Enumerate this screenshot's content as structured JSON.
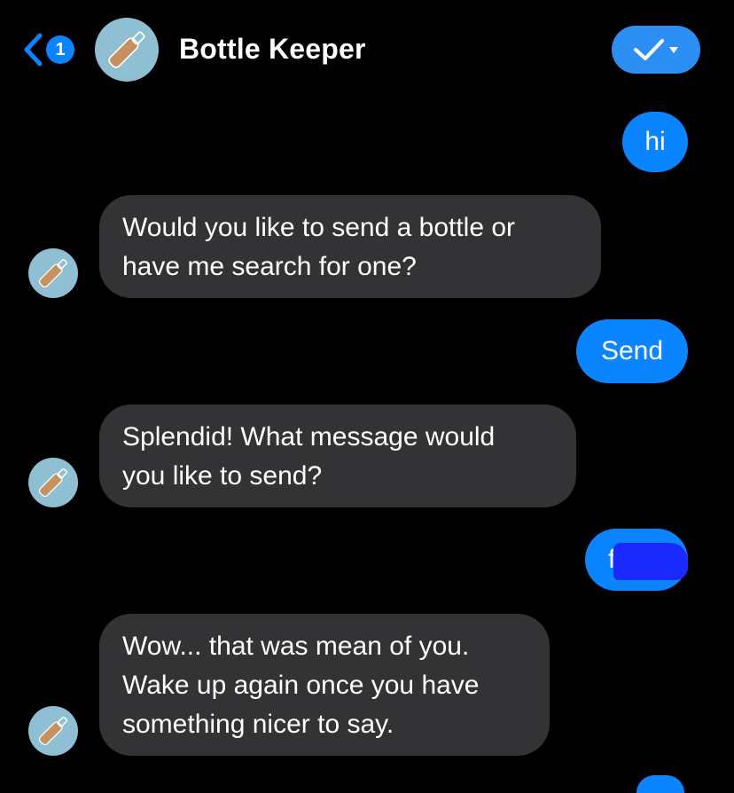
{
  "header": {
    "unread_count": "1",
    "title": "Bottle Keeper",
    "status_icon": "checkmark-dropdown",
    "accent": "#0a84ff"
  },
  "messages": [
    {
      "from": "user",
      "text": "hi"
    },
    {
      "from": "bot",
      "lines": [
        "Would you like to send a bottle or",
        "have me search for one?"
      ]
    },
    {
      "from": "user",
      "text": "Send"
    },
    {
      "from": "bot",
      "lines": [
        "Splendid! What message would",
        "you like to send?"
      ]
    },
    {
      "from": "user",
      "text": "fu"
    },
    {
      "from": "bot",
      "lines": [
        "Wow... that was mean of you.",
        "Wake up again once you have",
        "something nicer to say."
      ]
    }
  ],
  "colors": {
    "background": "#000000",
    "bot_bubble": "#333335",
    "user_bubble": "#0a84ff",
    "avatar_bg": "#8fbfd2",
    "bottle": "#c7905f"
  }
}
